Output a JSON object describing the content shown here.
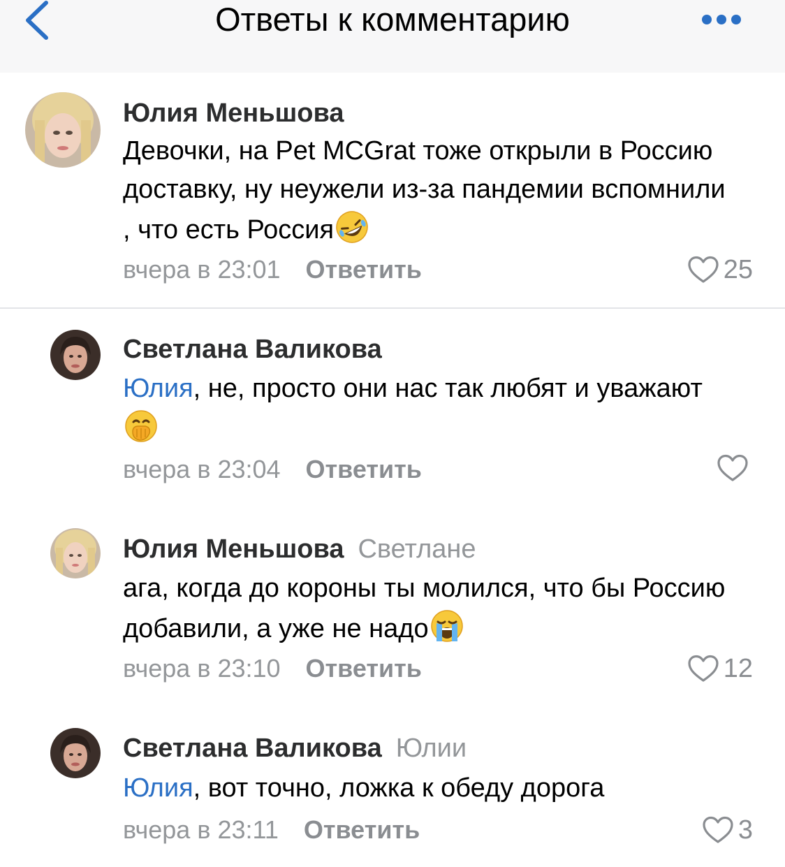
{
  "header": {
    "title": "Ответы к комментарию"
  },
  "comments": [
    {
      "author": "Юлия Меньшова",
      "reply_to": "",
      "mention": "",
      "text": "Девочки, на Pet MCGrat тоже открыли в Россию доставку, ну неужели из-за пандемии вспомнили , что есть Россия",
      "emoji": "rolling-on-floor-laughing-emoji",
      "time": "вчера в 23:01",
      "reply_label": "Ответить",
      "likes": "25"
    },
    {
      "author": "Светлана Валикова",
      "reply_to": "",
      "mention": "Юлия",
      "text": ", не, просто они нас так любят и уважают",
      "emoji": "face-with-hand-over-mouth-emoji",
      "time": "вчера в 23:04",
      "reply_label": "Ответить",
      "likes": ""
    },
    {
      "author": "Юлия Меньшова",
      "reply_to": "Светлане",
      "mention": "",
      "text": "ага, когда до короны ты молился, что бы Россию добавили, а уже не надо",
      "emoji": "loudly-crying-face-emoji",
      "time": "вчера в 23:10",
      "reply_label": "Ответить",
      "likes": "12"
    },
    {
      "author": "Светлана Валикова",
      "reply_to": "Юлии",
      "mention": "Юлия",
      "text": ", вот точно, ложка к обеду дорога",
      "emoji": "",
      "time": "вчера в 23:11",
      "reply_label": "Ответить",
      "likes": "3"
    }
  ],
  "colors": {
    "accent": "#2a6fc5",
    "secondary_text": "#939699",
    "header_bg": "#f7f7f8"
  },
  "icons": [
    "chevron-left-icon",
    "more-dots-icon",
    "heart-outline-icon"
  ]
}
